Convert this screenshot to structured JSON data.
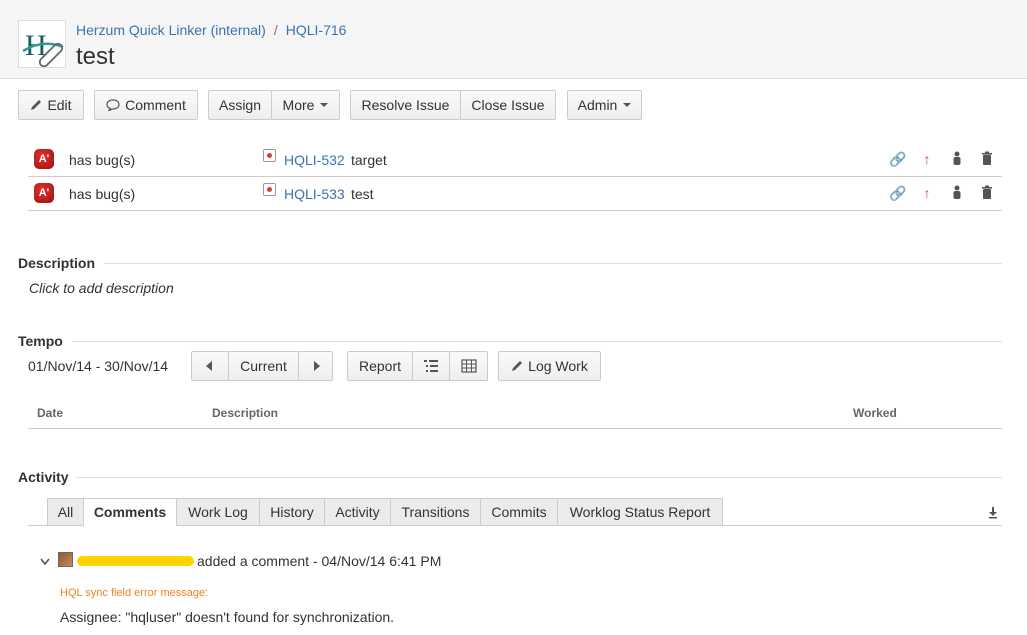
{
  "header": {
    "project": "Herzum Quick Linker (internal)",
    "separator": "/",
    "issue_key": "HQLI-716",
    "title": "test"
  },
  "toolbar": {
    "edit": "Edit",
    "comment": "Comment",
    "assign": "Assign",
    "more": "More",
    "resolve": "Resolve Issue",
    "close": "Close Issue",
    "admin": "Admin"
  },
  "links": [
    {
      "relation": "has bug(s)",
      "key": "HQLI-532",
      "summary": "target"
    },
    {
      "relation": "has bug(s)",
      "key": "HQLI-533",
      "summary": "test"
    }
  ],
  "description": {
    "title": "Description",
    "placeholder": "Click to add description"
  },
  "tempo": {
    "title": "Tempo",
    "range": "01/Nov/14 - 30/Nov/14",
    "current": "Current",
    "report": "Report",
    "log_work": "Log Work",
    "columns": [
      "Date",
      "Description",
      "Worked"
    ]
  },
  "activity": {
    "title": "Activity",
    "tabs": [
      "All",
      "Comments",
      "Work Log",
      "History",
      "Activity",
      "Transitions",
      "Commits",
      "Worklog Status Report"
    ],
    "active_tab": "Comments",
    "comment": {
      "action": "added a comment - 04/Nov/14 6:41 PM",
      "line1": "HQL sync field error message:",
      "line2": "Assignee: \"hqluser\" doesn't found for synchronization."
    }
  },
  "colors": {
    "link": "#3b73af",
    "bug": "#c02020",
    "warning_text": "#f0821e",
    "redaction": "#ffd400"
  }
}
